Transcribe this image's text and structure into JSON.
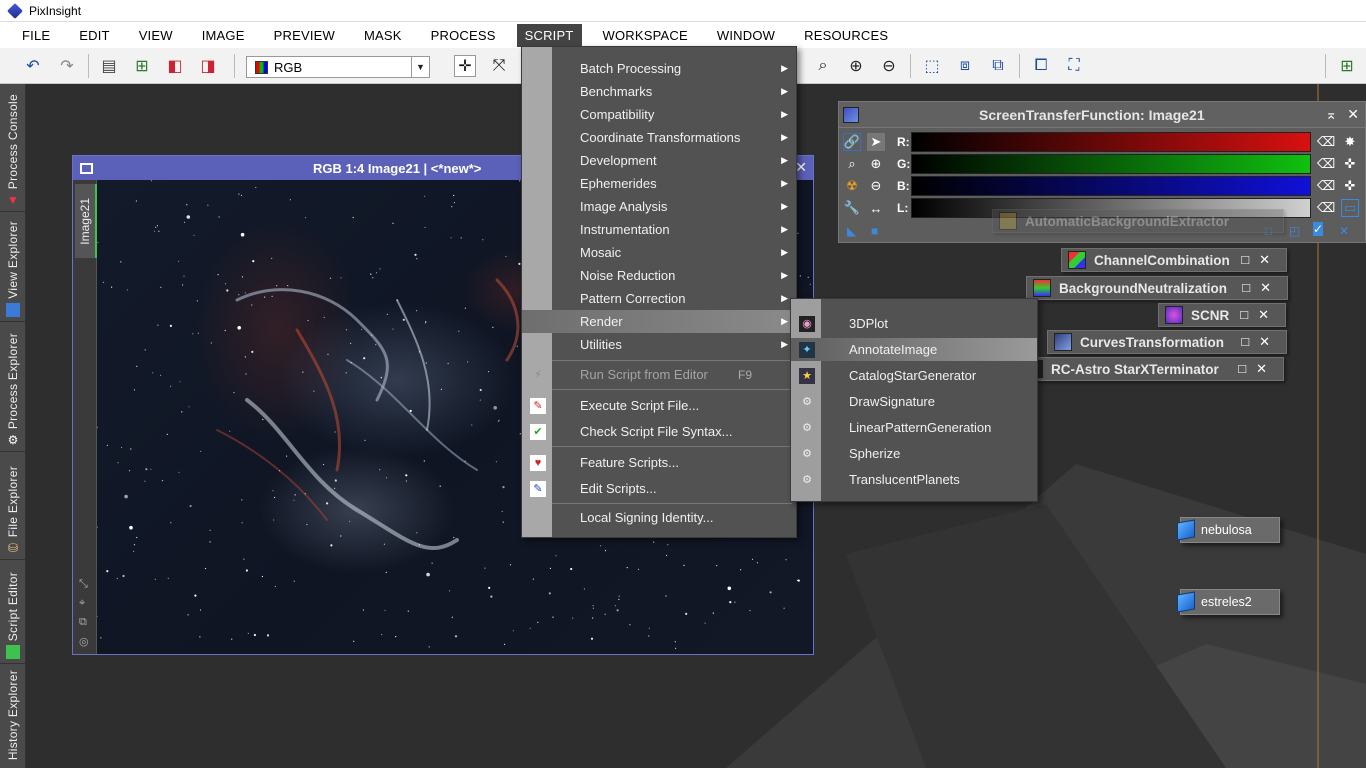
{
  "app": {
    "title": "PixInsight"
  },
  "menubar": [
    "FILE",
    "EDIT",
    "VIEW",
    "IMAGE",
    "PREVIEW",
    "MASK",
    "PROCESS",
    "SCRIPT",
    "WORKSPACE",
    "WINDOW",
    "RESOURCES"
  ],
  "toolbar": {
    "color_mode": "RGB"
  },
  "left_dock": {
    "tabs": [
      "Process Console",
      "View Explorer",
      "Process Explorer",
      "File Explorer",
      "Script Editor",
      "History Explorer"
    ]
  },
  "image_window": {
    "title": "RGB 1:4 Image21 | <*new*>",
    "tab_label": "Image21"
  },
  "stf": {
    "title": "ScreenTransferFunction: Image21",
    "channels": [
      {
        "label": "R:",
        "color": "#d81010"
      },
      {
        "label": "G:",
        "color": "#10c010"
      },
      {
        "label": "B:",
        "color": "#1010d8"
      },
      {
        "label": "L:",
        "color": "#d0d0d0"
      }
    ]
  },
  "process_icons": [
    {
      "label": "AutomaticBackgroundExtractor"
    },
    {
      "label": "ChannelCombination"
    },
    {
      "label": "BackgroundNeutralization"
    },
    {
      "label": "SCNR"
    },
    {
      "label": "CurvesTransformation"
    },
    {
      "label": "RC-Astro StarXTerminator"
    }
  ],
  "desktop_icons": [
    {
      "label": "nebulosa"
    },
    {
      "label": "estreles2"
    }
  ],
  "script_menu": {
    "items": [
      {
        "label": "Batch Processing",
        "submenu": true
      },
      {
        "label": "Benchmarks",
        "submenu": true
      },
      {
        "label": "Compatibility",
        "submenu": true
      },
      {
        "label": "Coordinate Transformations",
        "submenu": true
      },
      {
        "label": "Development",
        "submenu": true
      },
      {
        "label": "Ephemerides",
        "submenu": true
      },
      {
        "label": "Image Analysis",
        "submenu": true
      },
      {
        "label": "Instrumentation",
        "submenu": true
      },
      {
        "label": "Mosaic",
        "submenu": true
      },
      {
        "label": "Noise Reduction",
        "submenu": true
      },
      {
        "label": "Pattern Correction",
        "submenu": true
      },
      {
        "label": "Render",
        "submenu": true,
        "highlighted": true
      },
      {
        "label": "Utilities",
        "submenu": true
      }
    ],
    "run_script": {
      "label": "Run Script from Editor",
      "shortcut": "F9",
      "disabled": true
    },
    "file_items": [
      "Execute Script File...",
      "Check Script File Syntax..."
    ],
    "feature_items": [
      "Feature Scripts...",
      "Edit Scripts..."
    ],
    "identity_item": "Local Signing Identity..."
  },
  "render_submenu": {
    "items": [
      {
        "label": "3DPlot"
      },
      {
        "label": "AnnotateImage",
        "highlighted": true
      },
      {
        "label": "CatalogStarGenerator"
      },
      {
        "label": "DrawSignature"
      },
      {
        "label": "LinearPatternGeneration"
      },
      {
        "label": "Spherize"
      },
      {
        "label": "TranslucentPlanets"
      }
    ]
  }
}
